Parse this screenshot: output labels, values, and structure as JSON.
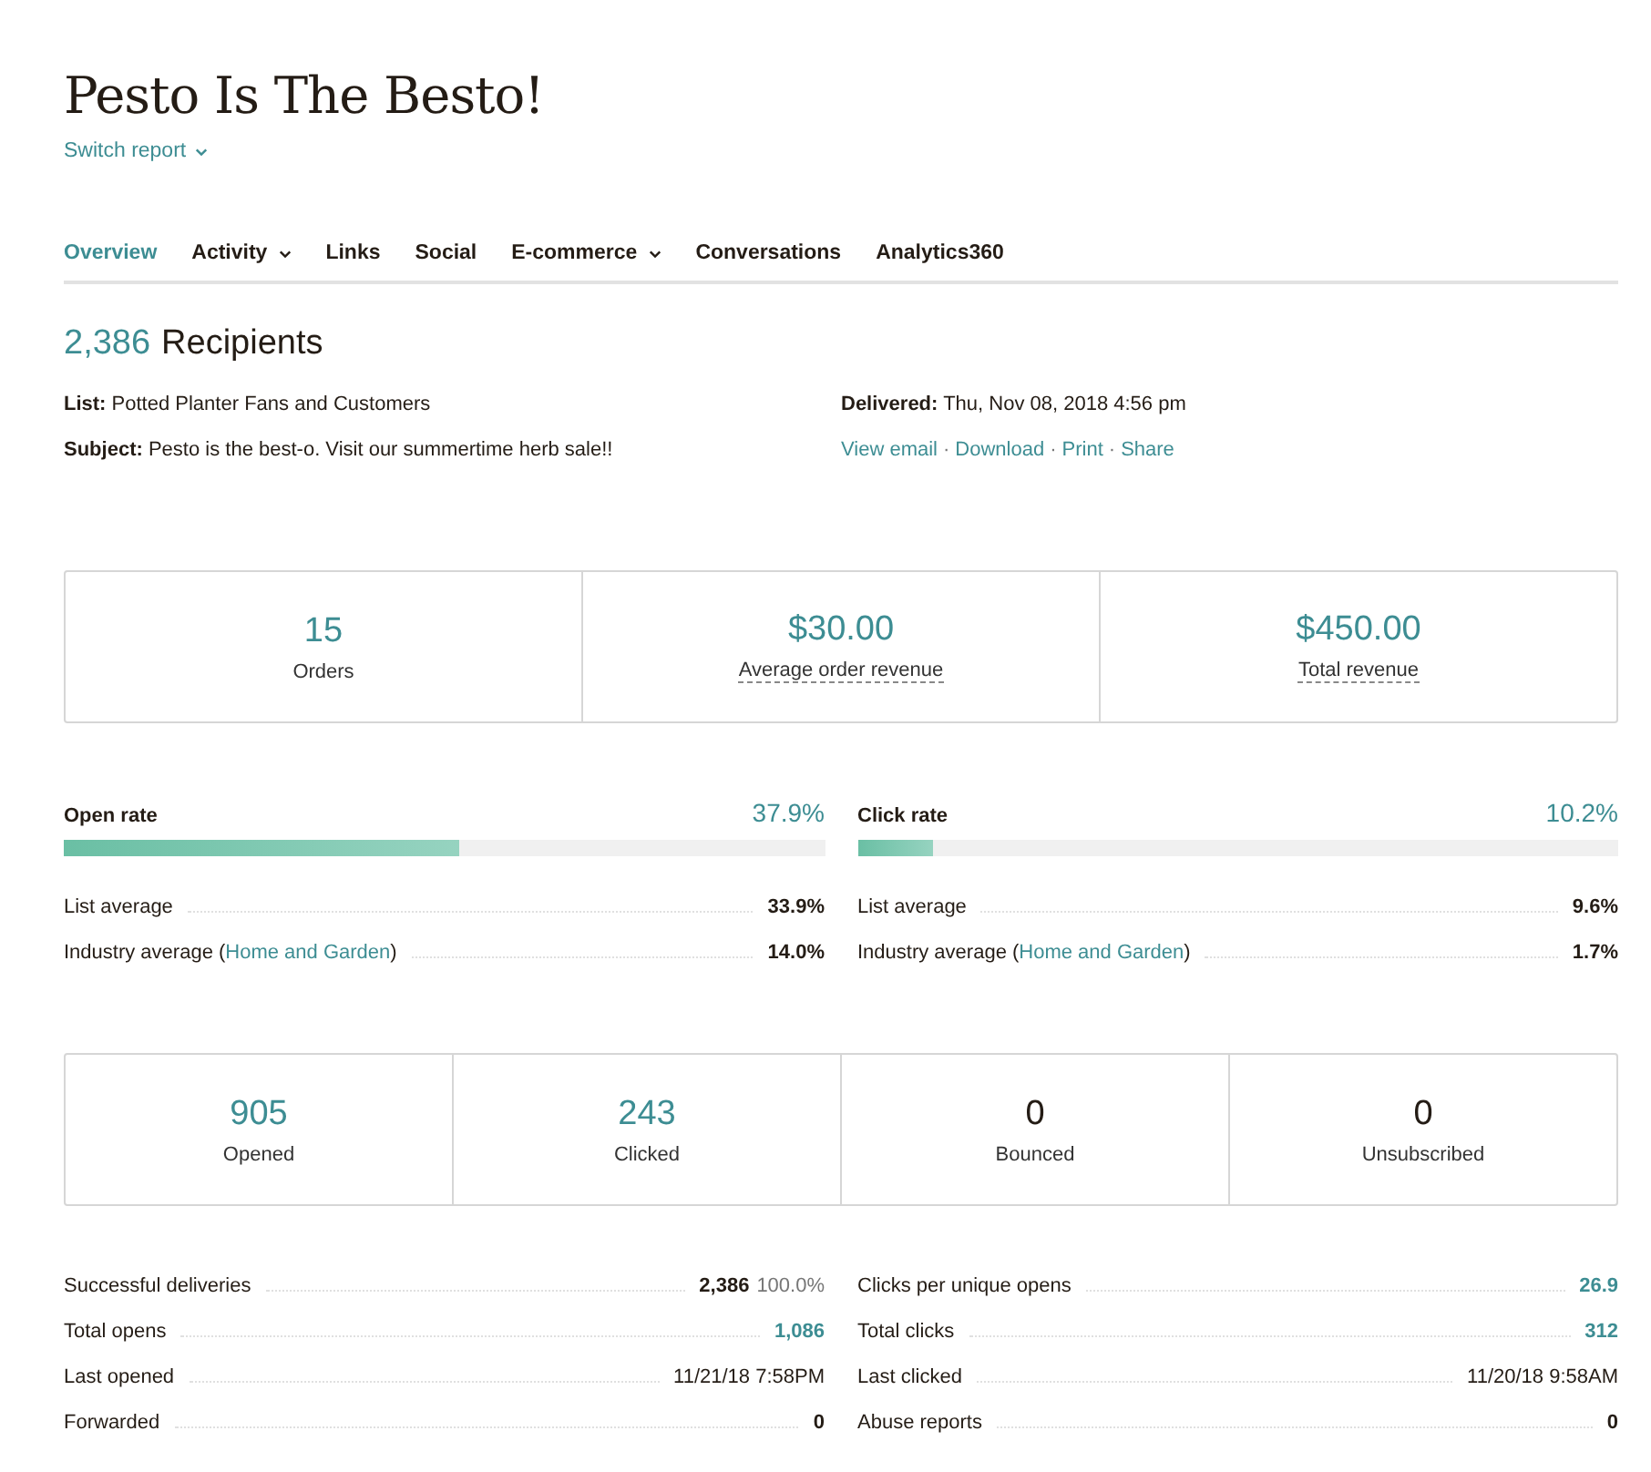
{
  "title": "Pesto Is The Besto!",
  "switch_report": "Switch report",
  "tabs": [
    {
      "label": "Overview",
      "selected": true,
      "dropdown": false
    },
    {
      "label": "Activity",
      "selected": false,
      "dropdown": true
    },
    {
      "label": "Links",
      "selected": false,
      "dropdown": false
    },
    {
      "label": "Social",
      "selected": false,
      "dropdown": false
    },
    {
      "label": "E-commerce",
      "selected": false,
      "dropdown": true
    },
    {
      "label": "Conversations",
      "selected": false,
      "dropdown": false
    },
    {
      "label": "Analytics360",
      "selected": false,
      "dropdown": false
    }
  ],
  "recipients": {
    "count": "2,386",
    "label": "Recipients"
  },
  "details": {
    "list_label": "List:",
    "list": "Potted Planter Fans and Customers",
    "subject_label": "Subject:",
    "subject": "Pesto is the best-o. Visit our summertime herb sale!!",
    "delivered_label": "Delivered:",
    "delivered": "Thu, Nov 08, 2018 4:56 pm",
    "actions": [
      "View email",
      "Download",
      "Print",
      "Share"
    ],
    "separator": "·"
  },
  "ecommerce": [
    {
      "value": "15",
      "label": "Orders",
      "underlined": false
    },
    {
      "value": "$30.00",
      "label": "Average order revenue",
      "underlined": true
    },
    {
      "value": "$450.00",
      "label": "Total revenue",
      "underlined": true
    }
  ],
  "rates": [
    {
      "label": "Open rate",
      "value": "37.9%",
      "level": 0.52,
      "list_average_label": "List average",
      "list_average": "33.9%",
      "industry_prefix": "Industry average (",
      "industry_link": "Home and Garden",
      "industry_suffix": ")",
      "industry_average": "14.0%"
    },
    {
      "label": "Click rate",
      "value": "10.2%",
      "level": 0.1,
      "list_average_label": "List average",
      "list_average": "9.6%",
      "industry_prefix": "Industry average (",
      "industry_link": "Home and Garden",
      "industry_suffix": ")",
      "industry_average": "1.7%"
    }
  ],
  "counts": [
    {
      "value": "905",
      "label": "Opened",
      "color": "#3d8d93"
    },
    {
      "value": "243",
      "label": "Clicked",
      "color": "#3d8d93"
    },
    {
      "value": "0",
      "label": "Bounced",
      "color": "#241c15"
    },
    {
      "value": "0",
      "label": "Unsubscribed",
      "color": "#241c15"
    }
  ],
  "stats": [
    [
      {
        "label": "Successful deliveries",
        "kind": "bold",
        "value": "2,386",
        "extra": "100.0%"
      },
      {
        "label": "Total opens",
        "kind": "link",
        "value": "1,086"
      },
      {
        "label": "Last opened",
        "kind": "plain",
        "value": "11/21/18 7:58PM"
      },
      {
        "label": "Forwarded",
        "kind": "bold",
        "value": "0"
      }
    ],
    [
      {
        "label": "Clicks per unique opens",
        "kind": "link",
        "value": "26.9"
      },
      {
        "label": "Total clicks",
        "kind": "link",
        "value": "312"
      },
      {
        "label": "Last clicked",
        "kind": "plain",
        "value": "11/20/18 9:58AM"
      },
      {
        "label": "Abuse reports",
        "kind": "bold",
        "value": "0"
      }
    ]
  ]
}
